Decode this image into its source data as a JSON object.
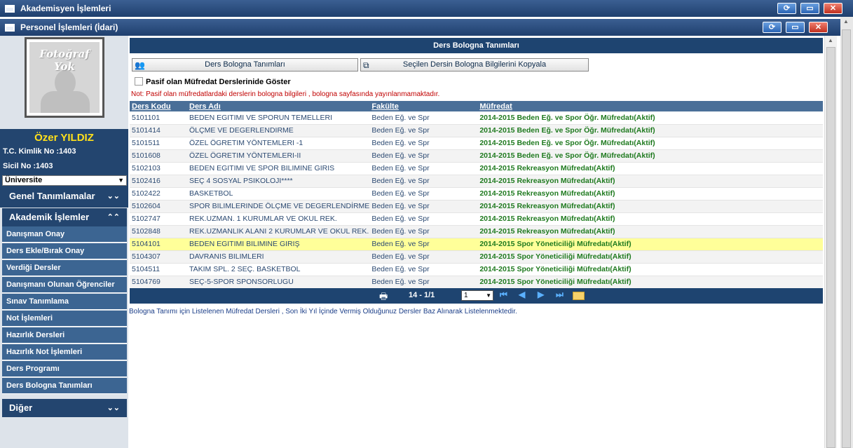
{
  "window1": {
    "title": "Akademisyen İşlemleri"
  },
  "window2": {
    "title": "Personel İşlemleri (İdari)"
  },
  "window_buttons": {
    "refresh": "⟳",
    "restore": "▭",
    "close": "✕"
  },
  "sidebar": {
    "photo_text": "Fotoğraf Yok",
    "user_name": "Özer YILDIZ",
    "tc_label": "T.C. Kimlik No :1403",
    "sicil_label": "Sicil No :1403",
    "unit_select": "Üniversite",
    "sections": [
      {
        "label": "Genel Tanımlamalar",
        "chev": "⌄⌄"
      },
      {
        "label": "Akademik İşlemler",
        "chev": "⌃⌃"
      },
      {
        "label": "Diğer",
        "chev": "⌄⌄"
      }
    ],
    "menu_items": [
      "Danışman Onay",
      "Ders Ekle/Bırak Onay",
      "Verdiği Dersler",
      "Danışmanı Olunan Öğrenciler",
      "Sınav Tanımlama",
      "Not İşlemleri",
      "Hazırlık Dersleri",
      "Hazırlık Not İşlemleri",
      "Ders Programı",
      "Ders Bologna Tanımları"
    ]
  },
  "main": {
    "panel_title": "Ders Bologna Tanımları",
    "btn_bologna": "Ders Bologna Tanımları",
    "btn_copy": "Seçilen Dersin Bologna Bilgilerini Kopyala",
    "checkbox_label": "Pasif olan Müfredat Derslerinide Göster",
    "note": "Not: Pasif olan müfredatlardaki derslerin bologna bilgileri , bologna sayfasında yayınlanmamaktadır.",
    "columns": [
      "Ders Kodu",
      "Ders Adı",
      "Fakülte",
      "Müfredat"
    ],
    "rows": [
      [
        "5101101",
        "BEDEN EGITIMI VE SPORUN TEMELLERI",
        "Beden Eğ. ve Spr",
        "2014-2015 Beden Eğ. ve Spor Öğr. Müfredatı(Aktif)"
      ],
      [
        "5101414",
        "ÖLÇME VE DEGERLENDIRME",
        "Beden Eğ. ve Spr",
        "2014-2015 Beden Eğ. ve Spor Öğr. Müfredatı(Aktif)"
      ],
      [
        "5101511",
        "ÖZEL ÖGRETIM YÖNTEMLERI -1",
        "Beden Eğ. ve Spr",
        "2014-2015 Beden Eğ. ve Spor Öğr. Müfredatı(Aktif)"
      ],
      [
        "5101608",
        "ÖZEL ÖGRETIM YÖNTEMLERI-II",
        "Beden Eğ. ve Spr",
        "2014-2015 Beden Eğ. ve Spor Öğr. Müfredatı(Aktif)"
      ],
      [
        "5102103",
        "BEDEN EGITIMI VE SPOR BILIMINE GIRIS",
        "Beden Eğ. ve Spr",
        "2014-2015 Rekreasyon Müfredatı(Aktif)"
      ],
      [
        "5102416",
        "SEÇ 4 SOSYAL PSIKOLOJI****",
        "Beden Eğ. ve Spr",
        "2014-2015 Rekreasyon Müfredatı(Aktif)"
      ],
      [
        "5102422",
        "BASKETBOL",
        "Beden Eğ. ve Spr",
        "2014-2015 Rekreasyon Müfredatı(Aktif)"
      ],
      [
        "5102604",
        "SPOR BILIMLERINDE ÖLÇME VE DEGERLENDİRME",
        "Beden Eğ. ve Spr",
        "2014-2015 Rekreasyon Müfredatı(Aktif)"
      ],
      [
        "5102747",
        "REK.UZMAN. 1 KURUMLAR VE OKUL REK.",
        "Beden Eğ. ve Spr",
        "2014-2015 Rekreasyon Müfredatı(Aktif)"
      ],
      [
        "5102848",
        "REK.UZMANLIK ALANI 2 KURUMLAR VE OKUL REK.",
        "Beden Eğ. ve Spr",
        "2014-2015 Rekreasyon Müfredatı(Aktif)"
      ],
      [
        "5104101",
        "BEDEN EGITIMI BILIMINE GIRIŞ",
        "Beden Eğ. ve Spr",
        "2014-2015 Spor Yöneticiliği Müfredatı(Aktif)"
      ],
      [
        "5104307",
        "DAVRANIS BILIMLERI",
        "Beden Eğ. ve Spr",
        "2014-2015 Spor Yöneticiliği Müfredatı(Aktif)"
      ],
      [
        "5104511",
        "TAKIM SPL. 2 SEÇ. BASKETBOL",
        "Beden Eğ. ve Spr",
        "2014-2015 Spor Yöneticiliği Müfredatı(Aktif)"
      ],
      [
        "5104769",
        "SEÇ-5-SPOR SPONSORLUGU",
        "Beden Eğ. ve Spr",
        "2014-2015 Spor Yöneticiliği Müfredatı(Aktif)"
      ]
    ],
    "highlighted_row": 10,
    "pager": {
      "info": "14 - 1/1",
      "page": "1"
    },
    "footnote": "Bologna Tanımı için Listelenen Müfredat Dersleri , Son İki Yıl İçinde Vermiş Olduğunuz Dersler Baz Alınarak Listelenmektedir."
  },
  "colors": {
    "nav_dark": "#23456f",
    "menu_item": "#3c6592",
    "highlight": "#ffff99",
    "curriculum_green": "#1f7a1f",
    "note_red": "#c00000"
  }
}
